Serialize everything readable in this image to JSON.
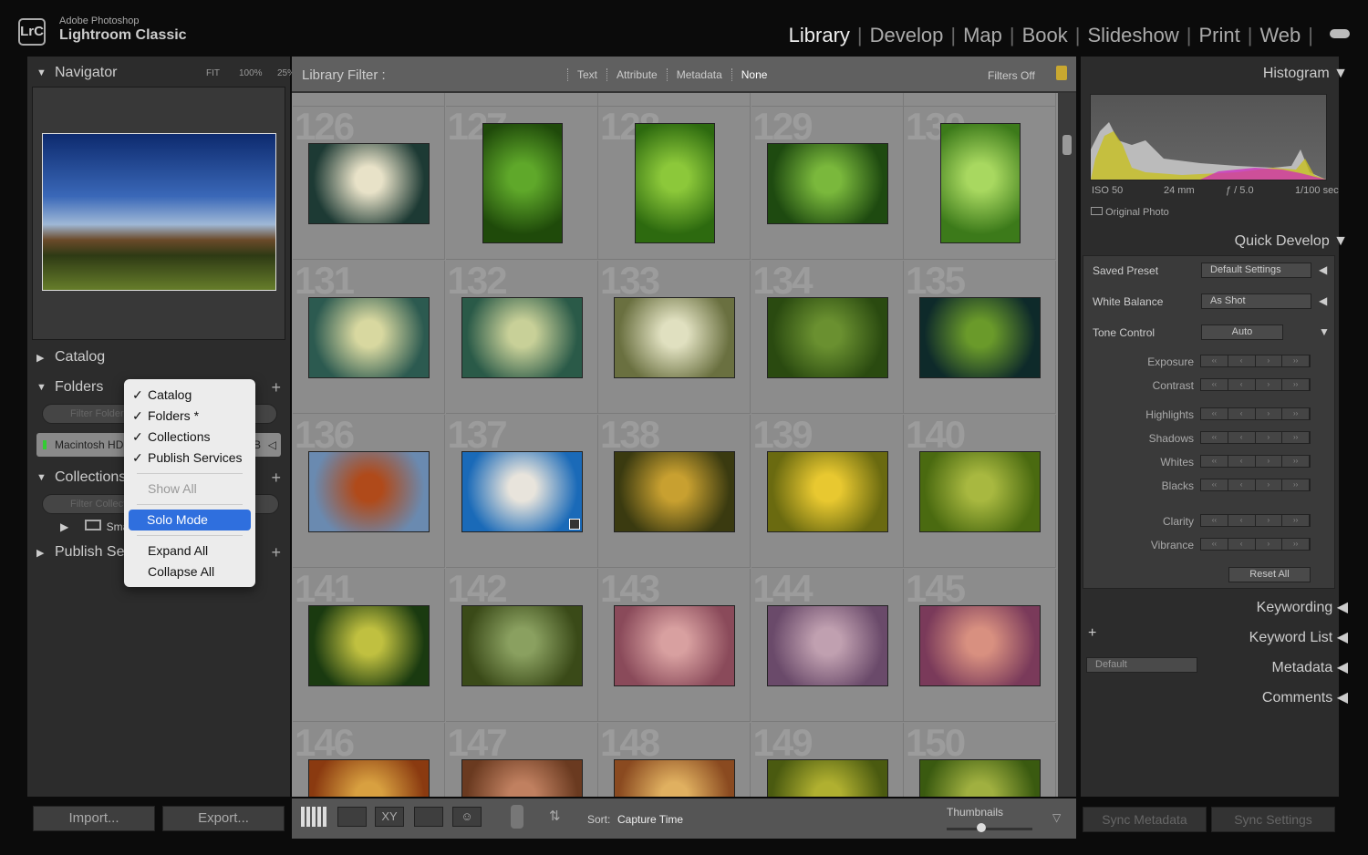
{
  "app": {
    "logo": "LrC",
    "vendor": "Adobe Photoshop",
    "name": "Lightroom Classic"
  },
  "modules": [
    "Library",
    "Develop",
    "Map",
    "Book",
    "Slideshow",
    "Print",
    "Web"
  ],
  "active_module": "Library",
  "left": {
    "navigator": {
      "title": "Navigator",
      "fit": "FIT",
      "z1": "100%",
      "z2": "25%"
    },
    "catalog": "Catalog",
    "folders": "Folders",
    "filter_folders": "Filter Folders",
    "volume": "Macintosh HD",
    "volume_suffix": "B",
    "collections": "Collections",
    "filter_collections": "Filter Collections",
    "smart": "Smart Collections",
    "publish": "Publish Services",
    "import": "Import...",
    "export": "Export..."
  },
  "menu": {
    "items": [
      {
        "label": "Catalog",
        "checked": true
      },
      {
        "label": "Folders *",
        "checked": true
      },
      {
        "label": "Collections",
        "checked": true
      },
      {
        "label": "Publish Services",
        "checked": true
      }
    ],
    "show_all": "Show All",
    "solo": "Solo Mode",
    "expand": "Expand All",
    "collapse": "Collapse All"
  },
  "filterbar": {
    "title": "Library Filter :",
    "tabs": [
      "Text",
      "Attribute",
      "Metadata",
      "None"
    ],
    "active": "None",
    "status": "Filters Off"
  },
  "grid": [
    {
      "n": "126",
      "p": false,
      "c": [
        "#1d3a34",
        "#e8e2c8"
      ]
    },
    {
      "n": "127",
      "p": true,
      "c": [
        "#1f4a0a",
        "#5fa82a"
      ]
    },
    {
      "n": "128",
      "p": true,
      "c": [
        "#2d6a0f",
        "#8cc83a"
      ]
    },
    {
      "n": "129",
      "p": false,
      "c": [
        "#1e4a10",
        "#7ab83c"
      ]
    },
    {
      "n": "130",
      "p": true,
      "c": [
        "#3c7a1a",
        "#a8d860"
      ]
    },
    {
      "n": "131",
      "p": false,
      "c": [
        "#2c5a50",
        "#d8d8a0"
      ]
    },
    {
      "n": "132",
      "p": false,
      "c": [
        "#2a5a48",
        "#c8d098"
      ]
    },
    {
      "n": "133",
      "p": false,
      "c": [
        "#6a7040",
        "#e0e0c0"
      ]
    },
    {
      "n": "134",
      "p": false,
      "c": [
        "#2a4a10",
        "#6a9030"
      ]
    },
    {
      "n": "135",
      "p": false,
      "c": [
        "#0e2a2a",
        "#6a9a2a"
      ]
    },
    {
      "n": "136",
      "p": false,
      "c": [
        "#6a8ab0",
        "#b04a1a"
      ]
    },
    {
      "n": "137",
      "p": false,
      "c": [
        "#1a6ab8",
        "#e8e4dc"
      ]
    },
    {
      "n": "138",
      "p": false,
      "c": [
        "#3a3a10",
        "#c8a030"
      ]
    },
    {
      "n": "139",
      "p": false,
      "c": [
        "#6a6a10",
        "#e8c830"
      ]
    },
    {
      "n": "140",
      "p": false,
      "c": [
        "#4a6a10",
        "#a8b840"
      ]
    },
    {
      "n": "141",
      "p": false,
      "c": [
        "#1a3a10",
        "#c0c040"
      ]
    },
    {
      "n": "142",
      "p": false,
      "c": [
        "#3a4a18",
        "#8aa060"
      ]
    },
    {
      "n": "143",
      "p": false,
      "c": [
        "#8a4a5a",
        "#d8a0a0"
      ]
    },
    {
      "n": "144",
      "p": false,
      "c": [
        "#6a4a6a",
        "#c0a0b0"
      ]
    },
    {
      "n": "145",
      "p": false,
      "c": [
        "#7a3a5a",
        "#d89080"
      ]
    },
    {
      "n": "146",
      "p": false,
      "c": [
        "#8a3a10",
        "#d8a040"
      ]
    },
    {
      "n": "147",
      "p": false,
      "c": [
        "#6a3a20",
        "#c08060"
      ]
    },
    {
      "n": "148",
      "p": false,
      "c": [
        "#8a4a20",
        "#e0b060"
      ]
    },
    {
      "n": "149",
      "p": false,
      "c": [
        "#4a5a10",
        "#b0b030"
      ]
    },
    {
      "n": "150",
      "p": false,
      "c": [
        "#3a5a10",
        "#a0b040"
      ]
    }
  ],
  "bottombar": {
    "sort_label": "Sort:",
    "sort_value": "Capture Time",
    "thumbnails": "Thumbnails",
    "thumb_size": 0.2
  },
  "right": {
    "histogram": "Histogram",
    "iso": "ISO 50",
    "focal": "24 mm",
    "aperture": "ƒ / 5.0",
    "shutter": "1/100 sec",
    "original": "Original Photo",
    "quick_develop": "Quick Develop",
    "saved_preset": "Saved Preset",
    "preset_value": "Default Settings",
    "white_balance": "White Balance",
    "wb_value": "As Shot",
    "tone_control": "Tone Control",
    "auto": "Auto",
    "sliders": [
      "Exposure",
      "Contrast",
      "Highlights",
      "Shadows",
      "Whites",
      "Blacks",
      "Clarity",
      "Vibrance"
    ],
    "reset": "Reset All",
    "keywording": "Keywording",
    "keyword_list": "Keyword List",
    "metadata": "Metadata",
    "metadata_preset": "Default",
    "comments": "Comments",
    "sync_metadata": "Sync Metadata",
    "sync_settings": "Sync Settings"
  },
  "colors": {
    "accent": "#2f6fde",
    "panel": "#2c2c2c",
    "grid_bg": "#8c8c8c"
  }
}
